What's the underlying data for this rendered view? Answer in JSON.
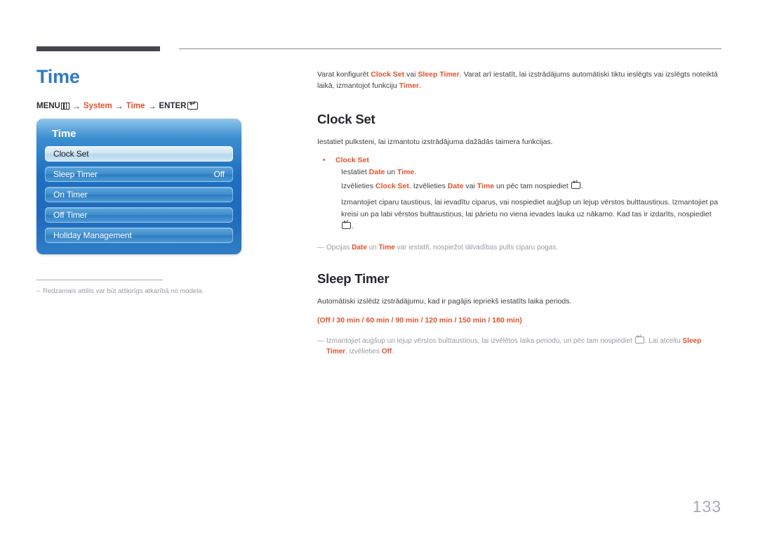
{
  "page": {
    "title": "Time",
    "number": "133"
  },
  "menu_path": {
    "menu_label": "MENU",
    "menu_icon": "menu-grid-icon",
    "arrow": "→",
    "item1": "System",
    "item2": "Time",
    "enter_label": "ENTER",
    "enter_icon": "enter-key-icon"
  },
  "osd": {
    "title": "Time",
    "items": [
      {
        "label": "Clock Set",
        "value": "",
        "selected": true
      },
      {
        "label": "Sleep Timer",
        "value": "Off",
        "selected": false
      },
      {
        "label": "On Timer",
        "value": "",
        "selected": false
      },
      {
        "label": "Off Timer",
        "value": "",
        "selected": false
      },
      {
        "label": "Holiday Management",
        "value": "",
        "selected": false
      }
    ]
  },
  "left_note": {
    "dash": "–",
    "text": "Redzamais attēls var būt atšķirīgs atkarībā no modeļa."
  },
  "intro": {
    "p1_a": "Varat konfigurēt ",
    "p1_b1": "Clock Set",
    "p1_c": " vai ",
    "p1_b2": "Sleep Timer",
    "p1_d": ". Varat arī iestatīt, lai izstrādājums automātiski tiktu ieslēgts vai izslēgts noteiktā laikā, izmantojot funkciju ",
    "p1_b3": "Timer",
    "p1_e": "."
  },
  "clock_set": {
    "heading": "Clock Set",
    "intro": "Iestatiet pulksteni, lai izmantotu izstrādājuma dažādās taimera funkcijas.",
    "bullet_label": "Clock Set",
    "line1_a": "Iestatiet ",
    "line1_b1": "Date",
    "line1_c": " un ",
    "line1_b2": "Time",
    "line1_d": ".",
    "line2_a": "Izvēlieties ",
    "line2_b1": "Clock Set",
    "line2_c": ". Izvēlieties ",
    "line2_b2": "Date",
    "line2_d": " vai ",
    "line2_b3": "Time",
    "line2_e": " un pēc tam nospiediet ",
    "line2_f": ".",
    "line3_a": "Izmantojiet ciparu taustiņus, lai ievadītu ciparus, vai nospiediet auģšup un lejup vērstos bulttaustiņus. Izmantojiet pa kreisi un pa labi vērstos bulttaustiņus, lai pārietu no viena ievades lauka uz nākamo. Kad tas ir izdarīts, nospiediet ",
    "line3_b": ".",
    "note_dash": "—",
    "note_a": "Opcijas ",
    "note_b1": "Date",
    "note_c": " un ",
    "note_b2": "Time",
    "note_d": " var iestatīt, nospiežot tālvadības pults ciparu pogas."
  },
  "sleep_timer": {
    "heading": "Sleep Timer",
    "intro": "Automātiski izslēdz izstrādājumu, kad ir pagājis iepriekš iestatīts laika periods.",
    "options": "(Off / 30 min / 60 min / 90 min / 120 min / 150 min / 180 min)",
    "note_dash": "—",
    "note_a": "Izmantojiet auģšup un lejup vērstos bulttaustiņus, lai izvēlētos laika periodu, un pēc tam nospiediet ",
    "note_b": ". Lai atceltu ",
    "note_bold1": "Sleep Timer",
    "note_c": ", izvēlieties ",
    "note_bold2": "Off",
    "note_d": "."
  },
  "colors": {
    "accent_blue": "#2d7cc0",
    "accent_orange": "#e0522c",
    "rule_dark": "#45454f",
    "note_grey": "#9a9aa6",
    "page_number": "#a8a8bb"
  }
}
